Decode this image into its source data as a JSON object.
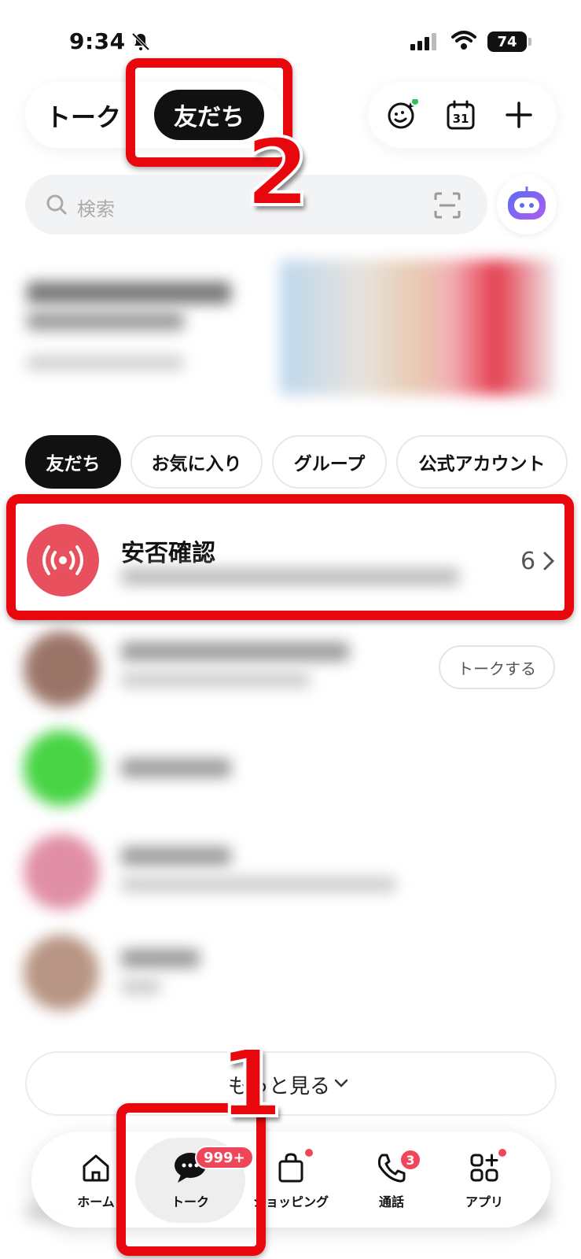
{
  "status_bar": {
    "time": "9:34",
    "battery": "74"
  },
  "header": {
    "tab_talk": "トーク",
    "tab_friends": "友だち"
  },
  "search": {
    "placeholder": "検索"
  },
  "filters": [
    "友だち",
    "お気に入り",
    "グループ",
    "公式アカウント"
  ],
  "safety_check": {
    "title": "安否確認",
    "count": "6"
  },
  "friend_actions": {
    "talk_button": "トークする"
  },
  "see_more": {
    "label": "もっと見る"
  },
  "bottom_nav": {
    "items": [
      {
        "label": "ホーム",
        "icon": "home-icon"
      },
      {
        "label": "トーク",
        "icon": "chat-bubble-icon",
        "badge": "999+"
      },
      {
        "label": "ショッピング",
        "icon": "shopping-bag-icon"
      },
      {
        "label": "通話",
        "icon": "phone-icon",
        "badge": "3"
      },
      {
        "label": "アプリ",
        "icon": "apps-grid-icon"
      }
    ]
  },
  "annotations": {
    "step1": "1",
    "step2": "2"
  },
  "colors": {
    "highlight_red": "#e8070d",
    "badge_red": "#f0465a",
    "safety_red": "#e8505e",
    "active_dark": "#111111"
  }
}
